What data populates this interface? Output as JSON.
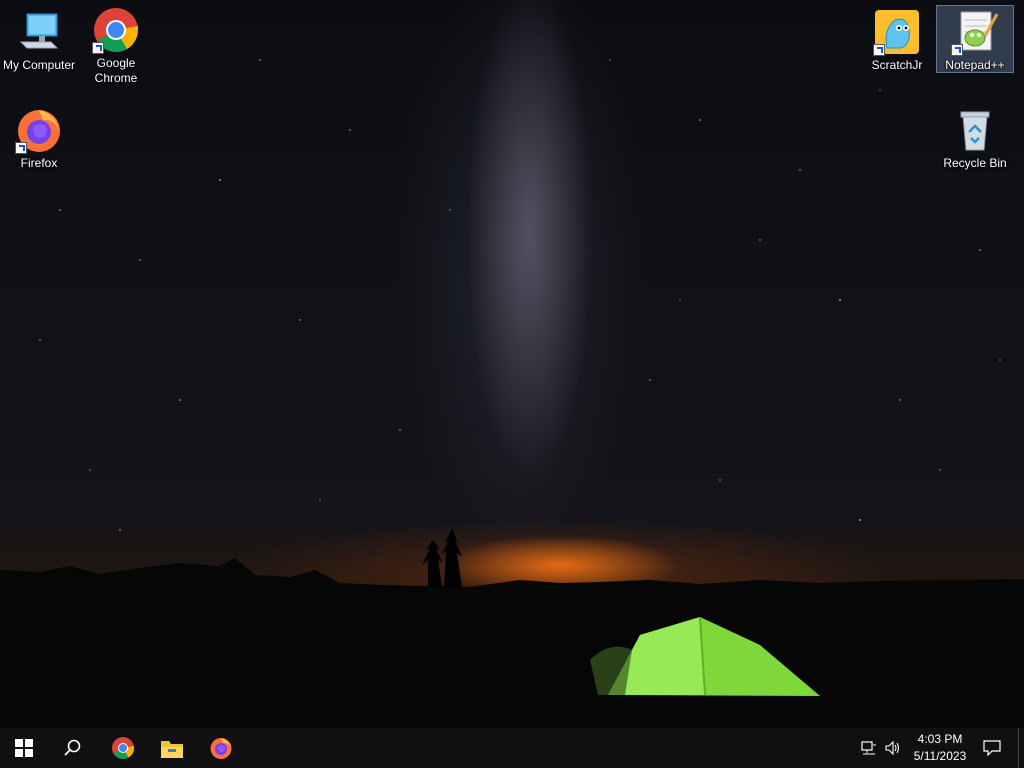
{
  "desktop": {
    "icons": [
      {
        "label": "My Computer",
        "icon": "computer-icon"
      },
      {
        "label": "Google Chrome",
        "icon": "chrome-icon"
      },
      {
        "label": "Firefox",
        "icon": "firefox-icon"
      },
      {
        "label": "ScratchJr",
        "icon": "scratchjr-icon"
      },
      {
        "label": "Notepad++",
        "icon": "notepadpp-icon"
      },
      {
        "label": "Recycle Bin",
        "icon": "recycle-bin-icon"
      }
    ]
  },
  "taskbar": {
    "pinned": [
      "start-icon",
      "search-icon",
      "chrome-icon",
      "file-explorer-icon",
      "firefox-icon"
    ],
    "tray": {
      "time": "4:03 PM",
      "date": "5/11/2023",
      "icons": [
        "network-icon",
        "volume-icon",
        "notification-icon"
      ]
    }
  },
  "colors": {
    "taskbar": "#101010",
    "selection": "#7896be",
    "tent": "#8ee34a"
  }
}
